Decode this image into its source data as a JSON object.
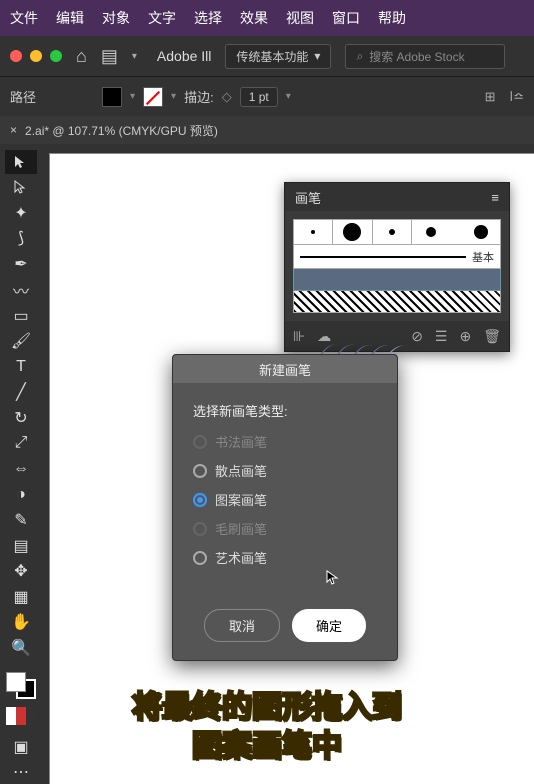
{
  "menu": {
    "file": "文件",
    "edit": "编辑",
    "object": "对象",
    "text": "文字",
    "select": "选择",
    "effect": "效果",
    "view": "视图",
    "window": "窗口",
    "help": "帮助"
  },
  "topbar": {
    "appname": "Adobe Ill",
    "preset": "传统基本功能",
    "search_placeholder": "搜索 Adobe Stock"
  },
  "props": {
    "path_label": "路径",
    "stroke_label": "描边:",
    "stroke_val": "1 pt"
  },
  "tab": {
    "close": "×",
    "title": "2.ai* @ 107.71% (CMYK/GPU 预览)"
  },
  "brush_panel": {
    "title": "画笔",
    "menu_icon": "≡",
    "basic_label": "基本"
  },
  "dialog": {
    "title": "新建画笔",
    "label": "选择新画笔类型:",
    "options": [
      {
        "label": "书法画笔",
        "disabled": true,
        "checked": false
      },
      {
        "label": "散点画笔",
        "disabled": false,
        "checked": false
      },
      {
        "label": "图案画笔",
        "disabled": false,
        "checked": true
      },
      {
        "label": "毛刷画笔",
        "disabled": true,
        "checked": false
      },
      {
        "label": "艺术画笔",
        "disabled": false,
        "checked": false
      }
    ],
    "cancel": "取消",
    "ok": "确定"
  },
  "caption": {
    "line1": "将最终的图形拖入到",
    "line2": "图案画笔中"
  },
  "icons": {
    "home": "⌂",
    "chev": "▾",
    "search": "⌕",
    "share": "⇪",
    "arrange": "⊞",
    "library": "ℬ",
    "folder": "▦",
    "trash": "🗑"
  }
}
